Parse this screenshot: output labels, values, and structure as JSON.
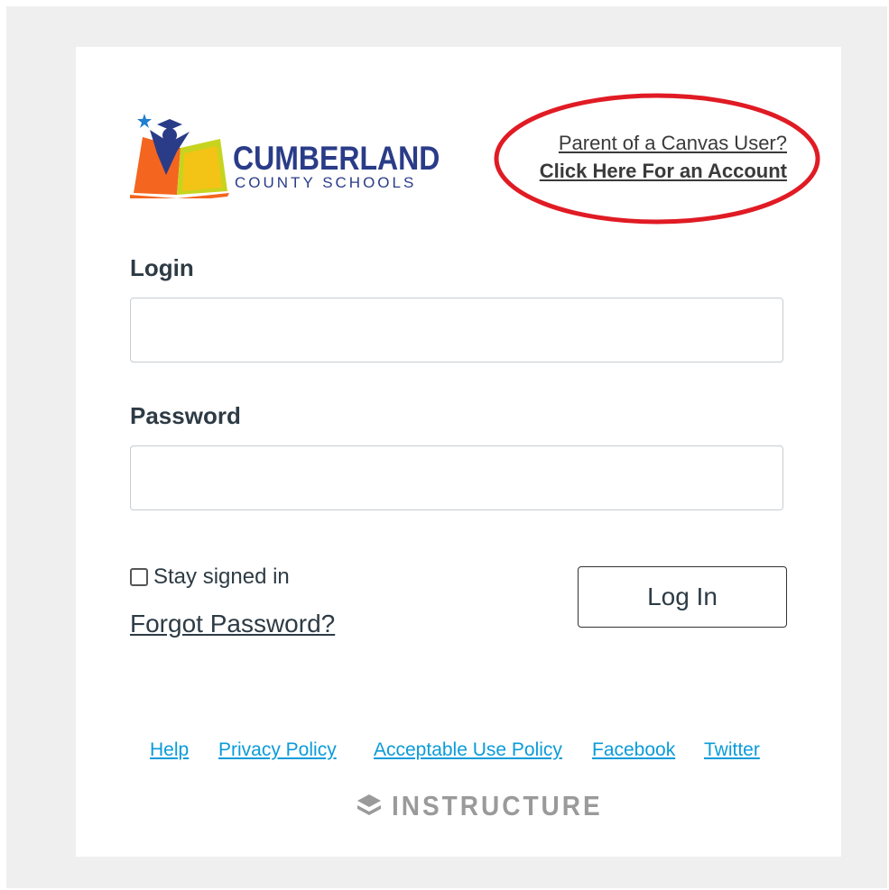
{
  "logo": {
    "word": "CUMBERLAND",
    "sub": "COUNTY SCHOOLS",
    "colors": {
      "navy": "#2a3c88",
      "orange": "#f4651f",
      "yellow": "#f3c315",
      "green": "#c7d41f",
      "blue": "#1f7fd0"
    }
  },
  "parent_link": {
    "line1": "Parent of a Canvas User?",
    "line2": "Click Here For an Account"
  },
  "highlight_color": "#e01b24",
  "form": {
    "login_label": "Login",
    "login_value": "",
    "password_label": "Password",
    "password_value": "",
    "stay_signed_in_label": "Stay signed in",
    "stay_signed_in_checked": false,
    "forgot_label": "Forgot Password?",
    "submit_label": "Log In"
  },
  "footer": {
    "links": [
      "Help",
      "Privacy Policy",
      "Acceptable Use Policy",
      "Facebook",
      "Twitter"
    ],
    "link_color": "#0b9bd9",
    "powered_by": "INSTRUCTURE",
    "powered_icon": "instructure-logo-icon"
  }
}
